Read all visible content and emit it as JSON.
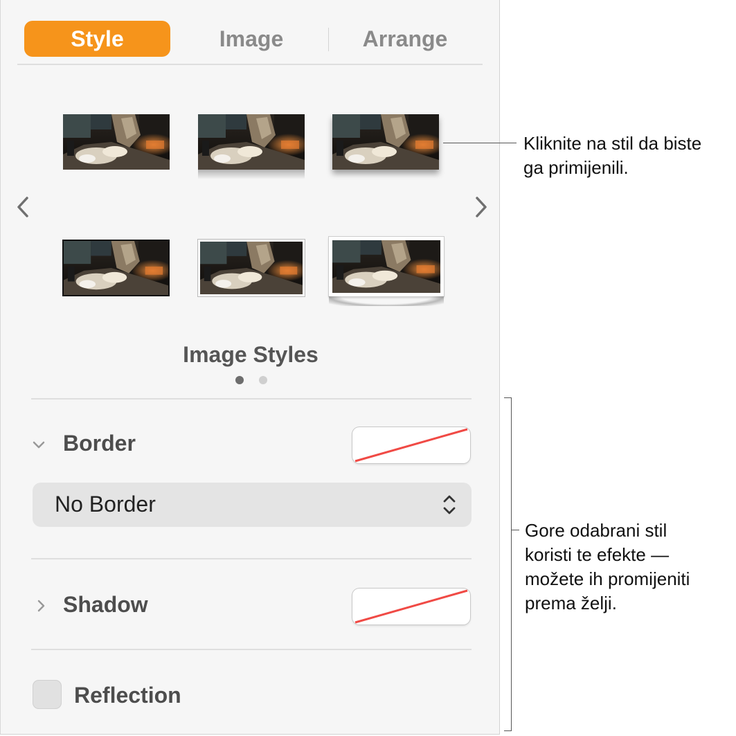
{
  "tabs": [
    {
      "label": "Style",
      "active": true
    },
    {
      "label": "Image",
      "active": false
    },
    {
      "label": "Arrange",
      "active": false
    }
  ],
  "styles_gallery": {
    "title": "Image Styles",
    "page_count": 2,
    "current_page": 1,
    "styles": [
      {
        "name": "plain"
      },
      {
        "name": "reflection"
      },
      {
        "name": "drop-shadow"
      },
      {
        "name": "thin-black-border"
      },
      {
        "name": "thin-white-border"
      },
      {
        "name": "thick-white-border-curl-shadow"
      }
    ]
  },
  "border": {
    "label": "Border",
    "expanded": true,
    "color": "none",
    "type_value": "No Border"
  },
  "shadow": {
    "label": "Shadow",
    "expanded": false,
    "color": "none"
  },
  "reflection": {
    "label": "Reflection",
    "checked": false
  },
  "callouts": {
    "styles": "Kliknite na stil da biste\nga primijenili.",
    "effects": "Gore odabrani stil\nkoristi te efekte —\nmožete ih promijeniti\nprema želji."
  },
  "colors": {
    "accent": "#f6941b",
    "none_slash": "#f04a45"
  }
}
